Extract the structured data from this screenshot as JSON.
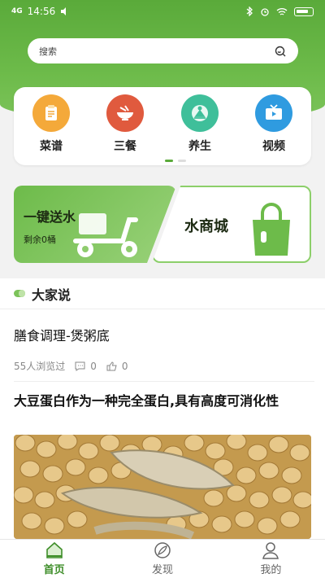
{
  "status": {
    "time": "14:56",
    "signal": "4G"
  },
  "search": {
    "placeholder": "搜索"
  },
  "categories": [
    {
      "label": "菜谱",
      "color": "#f4a93a",
      "icon": "recipe-icon"
    },
    {
      "label": "三餐",
      "color": "#e05a3e",
      "icon": "bowl-icon"
    },
    {
      "label": "养生",
      "color": "#3fbf9a",
      "icon": "wellness-icon"
    },
    {
      "label": "视频",
      "color": "#2f9be0",
      "icon": "tv-icon"
    }
  ],
  "water": {
    "send_label": "一键送水",
    "remaining": "剩余0桶",
    "shop_label": "水商城"
  },
  "section": {
    "title": "大家说"
  },
  "articles": [
    {
      "title": "膳食调理-煲粥底",
      "views": "55人浏览过",
      "comments": "0",
      "likes": "0"
    },
    {
      "title": "大豆蛋白作为一种完全蛋白,具有高度可消化性"
    }
  ],
  "tabs": [
    {
      "label": "首页",
      "icon": "home-icon"
    },
    {
      "label": "发现",
      "icon": "discover-icon"
    },
    {
      "label": "我的",
      "icon": "profile-icon"
    }
  ],
  "colors": {
    "brand": "#5aaa3a",
    "active_tab": "#3f8e2a"
  }
}
